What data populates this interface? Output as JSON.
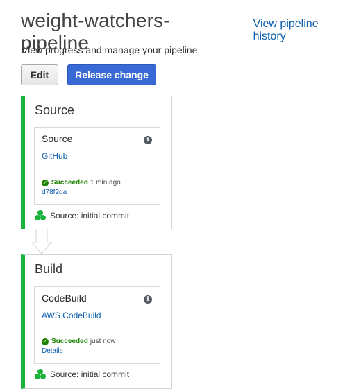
{
  "header": {
    "title": "weight-watchers-pipeline",
    "history_link": "View pipeline history",
    "subtitle": "View progress and manage your pipeline."
  },
  "toolbar": {
    "edit_label": "Edit",
    "release_label": "Release change"
  },
  "stages": [
    {
      "title": "Source",
      "action": {
        "name": "Source",
        "provider": "GitHub",
        "status": "Succeeded",
        "time": "1 min ago",
        "link": "d78f2da"
      },
      "commit": "Source: initial commit"
    },
    {
      "title": "Build",
      "action": {
        "name": "CodeBuild",
        "provider": "AWS CodeBuild",
        "status": "Succeeded",
        "time": "just now",
        "link": "Details"
      },
      "commit": "Source: initial commit"
    }
  ],
  "colors": {
    "success": "#1d8102",
    "stage_bar": "#1ab33c",
    "primary": "#3869d4",
    "link": "#0a5eaf"
  },
  "icons": {
    "info": "info-icon",
    "status": "check-circle-icon",
    "commit": "source-revision-icon"
  }
}
